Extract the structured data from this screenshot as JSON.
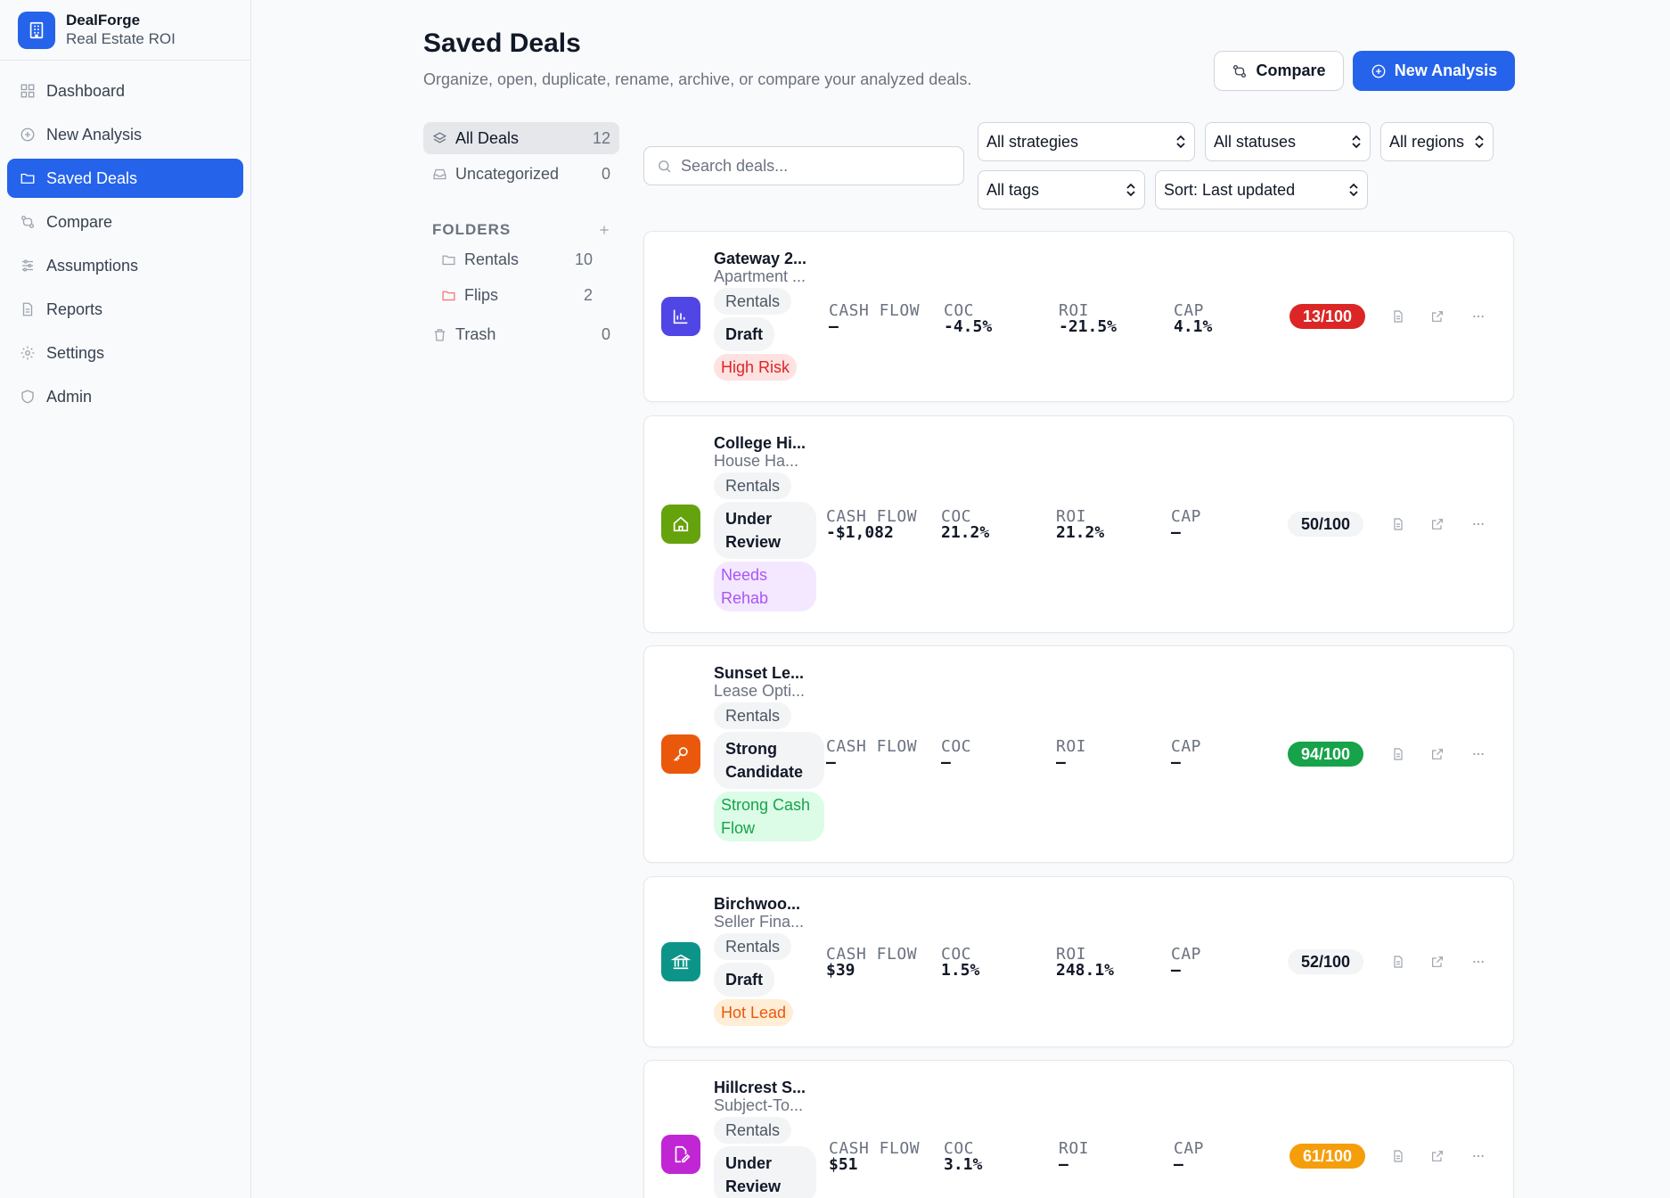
{
  "brand": {
    "name": "DealForge",
    "subtitle": "Real Estate ROI"
  },
  "nav": [
    {
      "label": "Dashboard",
      "icon": "grid-icon"
    },
    {
      "label": "New Analysis",
      "icon": "plus-circle-icon"
    },
    {
      "label": "Saved Deals",
      "icon": "folder-icon",
      "active": true
    },
    {
      "label": "Compare",
      "icon": "compare-icon"
    },
    {
      "label": "Assumptions",
      "icon": "sliders-icon"
    },
    {
      "label": "Reports",
      "icon": "file-icon"
    },
    {
      "label": "Settings",
      "icon": "gear-icon"
    },
    {
      "label": "Admin",
      "icon": "shield-icon"
    }
  ],
  "header": {
    "title": "Saved Deals",
    "subtitle": "Organize, open, duplicate, rename, archive, or compare your analyzed deals.",
    "compare_label": "Compare",
    "new_label": "New Analysis"
  },
  "folders": {
    "all": {
      "label": "All Deals",
      "count": "12"
    },
    "uncategorized": {
      "label": "Uncategorized",
      "count": "0"
    },
    "heading": "FOLDERS",
    "items": [
      {
        "label": "Rentals",
        "count": "10"
      },
      {
        "label": "Flips",
        "count": "2"
      }
    ],
    "trash": {
      "label": "Trash",
      "count": "0"
    }
  },
  "filters": {
    "search_placeholder": "Search deals...",
    "strategy": "All strategies",
    "status": "All statuses",
    "region": "All regions",
    "tags": "All tags",
    "sort": "Sort: Last updated"
  },
  "metric_labels": {
    "cash_flow": "CASH FLOW",
    "coc": "COC",
    "roi": "ROI",
    "cap": "CAP"
  },
  "deals": [
    {
      "name": "Gateway 2...",
      "type": "Apartment ...",
      "folder": "Rentals",
      "status": "Draft",
      "tag": "High Risk",
      "cash_flow": "—",
      "coc": "-4.5%",
      "roi": "-21.5%",
      "cap": "4.1%",
      "score": "13/100",
      "icon_color": "#4f46e5",
      "score_bg": "#dc2626",
      "score_fg": "#ffffff",
      "tag_bg": "#fee2e2",
      "tag_fg": "#dc2626"
    },
    {
      "name": "College Hi...",
      "type": "House Ha...",
      "folder": "Rentals",
      "status": "Under Review",
      "tag": "Needs Rehab",
      "cash_flow": "-$1,082",
      "coc": "21.2%",
      "roi": "21.2%",
      "cap": "—",
      "score": "50/100",
      "icon_color": "#65a30d",
      "score_bg": "#f3f4f6",
      "score_fg": "#111827",
      "tag_bg": "#f3e8ff",
      "tag_fg": "#a855f7"
    },
    {
      "name": "Sunset Le...",
      "type": "Lease Opti...",
      "folder": "Rentals",
      "status": "Strong Candidate",
      "tag": "Strong Cash Flow",
      "cash_flow": "—",
      "coc": "—",
      "roi": "—",
      "cap": "—",
      "score": "94/100",
      "icon_color": "#ea580c",
      "score_bg": "#16a34a",
      "score_fg": "#ffffff",
      "tag_bg": "#dcfce7",
      "tag_fg": "#16a34a"
    },
    {
      "name": "Birchwoo...",
      "type": "Seller Fina...",
      "folder": "Rentals",
      "status": "Draft",
      "tag": "Hot Lead",
      "cash_flow": "$39",
      "coc": "1.5%",
      "roi": "248.1%",
      "cap": "—",
      "score": "52/100",
      "icon_color": "#0d9488",
      "score_bg": "#f3f4f6",
      "score_fg": "#111827",
      "tag_bg": "#ffedd5",
      "tag_fg": "#ea580c"
    },
    {
      "name": "Hillcrest S...",
      "type": "Subject-To...",
      "folder": "Rentals",
      "status": "Under Review",
      "tag": "",
      "cash_flow": "$51",
      "coc": "3.1%",
      "roi": "—",
      "cap": "—",
      "score": "61/100",
      "icon_color": "#c026d3",
      "score_bg": "#f59e0b",
      "score_fg": "#ffffff",
      "tag_bg": "#f3f4f6",
      "tag_fg": "#4b5563"
    }
  ]
}
